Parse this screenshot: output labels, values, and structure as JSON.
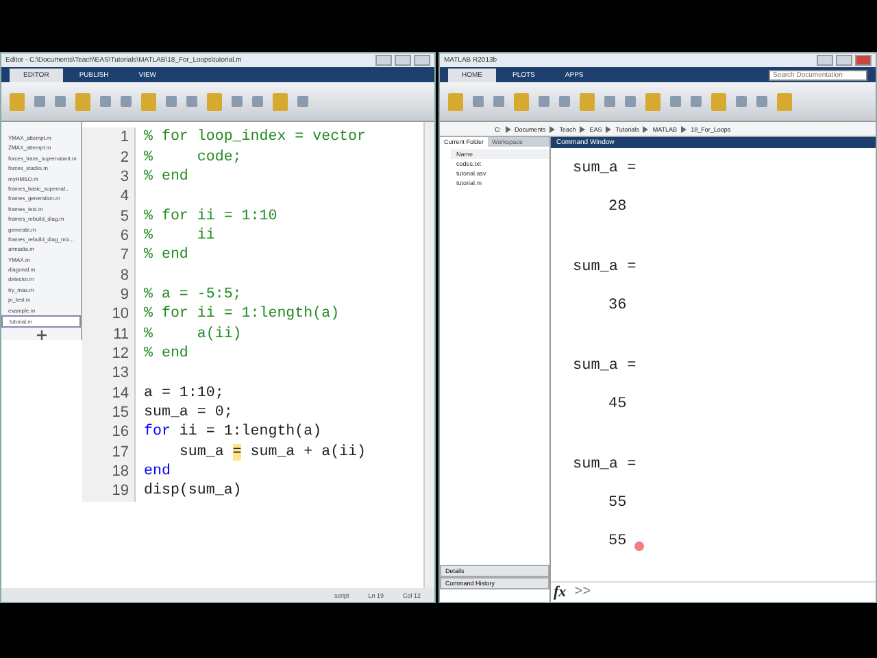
{
  "editor": {
    "title": "Editor - C:\\Documents\\Teach\\EAS\\Tutorials\\MATLAB\\18_For_Loops\\tutorial.m",
    "tabs": [
      {
        "label": "EDITOR",
        "selected": true
      },
      {
        "label": "PUBLISH",
        "selected": false
      },
      {
        "label": "VIEW",
        "selected": false
      }
    ],
    "files": [
      {
        "name": "YMAX_attempt.m",
        "selected": false
      },
      {
        "name": "ZMAX_attempt.m",
        "selected": false
      },
      {
        "name": "forces_trans_supernatant.m",
        "selected": false
      },
      {
        "name": "forces_stacks.m",
        "selected": false
      },
      {
        "name": "myHMSO.m",
        "selected": false
      },
      {
        "name": "frames_basic_supernat...",
        "selected": false
      },
      {
        "name": "frames_generation.m",
        "selected": false
      },
      {
        "name": "frames_test.m",
        "selected": false
      },
      {
        "name": "frames_rebuild_diag.m",
        "selected": false
      },
      {
        "name": "generate.m",
        "selected": false
      },
      {
        "name": "frames_rebuild_diag_mix...",
        "selected": false
      },
      {
        "name": "armadia.m",
        "selected": false
      },
      {
        "name": "YMAX.m",
        "selected": false
      },
      {
        "name": "diagonal.m",
        "selected": false
      },
      {
        "name": "detector.m",
        "selected": false
      },
      {
        "name": "try_max.m",
        "selected": false
      },
      {
        "name": "pi_test.m",
        "selected": false
      },
      {
        "name": "example.m",
        "selected": false
      },
      {
        "name": "tutorial.m",
        "selected": true
      }
    ],
    "lines": [
      {
        "number": "1",
        "segments": [
          {
            "kind": "comment",
            "text": "% for loop_index = vector"
          }
        ]
      },
      {
        "number": "2",
        "segments": [
          {
            "kind": "comment",
            "text": "%     code;"
          }
        ]
      },
      {
        "number": "3",
        "segments": [
          {
            "kind": "comment",
            "text": "% end"
          }
        ]
      },
      {
        "number": "4"
      },
      {
        "number": "5",
        "segments": [
          {
            "kind": "comment",
            "text": "% for ii = 1:10"
          }
        ]
      },
      {
        "number": "6",
        "segments": [
          {
            "kind": "comment",
            "text": "%     ii"
          }
        ]
      },
      {
        "number": "7",
        "segments": [
          {
            "kind": "comment",
            "text": "% end"
          }
        ]
      },
      {
        "number": "8"
      },
      {
        "number": "9",
        "segments": [
          {
            "kind": "comment",
            "text": "% a = -5:5;"
          }
        ]
      },
      {
        "number": "10",
        "segments": [
          {
            "kind": "comment",
            "text": "% for ii = 1:length(a)"
          }
        ]
      },
      {
        "number": "11",
        "segments": [
          {
            "kind": "comment",
            "text": "%     a(ii)"
          }
        ]
      },
      {
        "number": "12",
        "segments": [
          {
            "kind": "comment",
            "text": "% end"
          }
        ]
      },
      {
        "number": "13"
      },
      {
        "number": "14",
        "segments": [
          {
            "kind": "plain",
            "text": "a = 1:10;"
          }
        ]
      },
      {
        "number": "15",
        "segments": [
          {
            "kind": "plain",
            "text": "sum_a = 0;"
          }
        ]
      },
      {
        "number": "16",
        "segments": [
          {
            "kind": "keyword",
            "text": "for"
          },
          {
            "kind": "plain",
            "text": " ii = 1:length(a)"
          }
        ]
      },
      {
        "number": "17",
        "segments": [
          {
            "kind": "plain",
            "text": "    sum_a "
          },
          {
            "kind": "highlight",
            "text": "="
          },
          {
            "kind": "plain",
            "text": " sum_a + a(ii)"
          }
        ]
      },
      {
        "number": "18",
        "segments": [
          {
            "kind": "keyword",
            "text": "end"
          }
        ]
      },
      {
        "number": "19",
        "segments": [
          {
            "kind": "plain",
            "text": "disp(sum_a)"
          }
        ]
      }
    ],
    "status": [
      {
        "text": "script"
      },
      {
        "text": "Ln  19"
      },
      {
        "text": "Col  12"
      }
    ]
  },
  "matlab": {
    "title": "MATLAB R2013b",
    "tabs": [
      {
        "label": "HOME",
        "selected": true
      },
      {
        "label": "PLOTS",
        "selected": false
      },
      {
        "label": "APPS",
        "selected": false
      }
    ],
    "search": {
      "placeholder": "Search Documentation"
    },
    "path": [
      "C:",
      "Documents",
      "Teach",
      "EAS",
      "Tutorials",
      "MATLAB",
      "18_For_Loops"
    ],
    "folder_tabs": [
      {
        "label": "Current Folder",
        "selected": true
      },
      {
        "label": "Workspace",
        "selected": false
      }
    ],
    "folder_header": "Name",
    "folder_files": [
      "codes.txt",
      "tutorial.asv",
      "tutorial.m"
    ],
    "details": "Details",
    "history": "Command History",
    "command_title": "Command Window",
    "output": [
      {
        "kind": "label",
        "text": "sum_a ="
      },
      {
        "kind": "value",
        "text": "28"
      },
      {
        "kind": "label",
        "text": "sum_a ="
      },
      {
        "kind": "value",
        "text": "36"
      },
      {
        "kind": "label",
        "text": "sum_a ="
      },
      {
        "kind": "value",
        "text": "45"
      },
      {
        "kind": "label",
        "text": "sum_a ="
      },
      {
        "kind": "value",
        "text": "55"
      },
      {
        "kind": "result",
        "text": "55"
      }
    ],
    "fx": "fx",
    "prompt": ">>"
  }
}
